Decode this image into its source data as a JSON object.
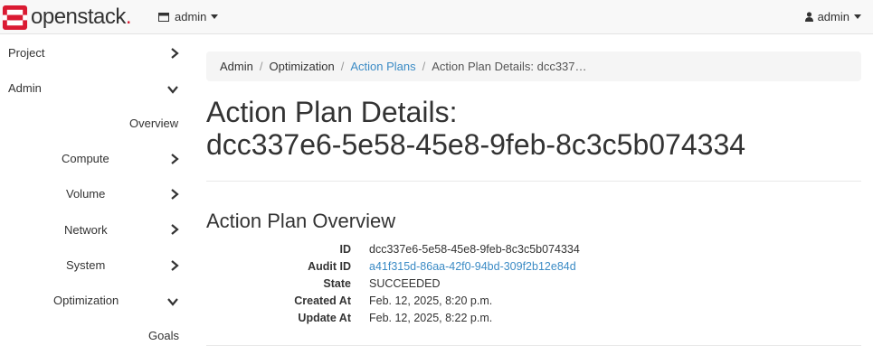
{
  "topbar": {
    "brand": "openstack",
    "brand_dot": ".",
    "project_label": "admin",
    "user_label": "admin"
  },
  "sidebar": {
    "items": [
      {
        "label": "Project",
        "state": "collapsed"
      },
      {
        "label": "Admin",
        "state": "expanded"
      },
      {
        "label": "Overview"
      },
      {
        "label": "Compute",
        "state": "collapsed"
      },
      {
        "label": "Volume",
        "state": "collapsed"
      },
      {
        "label": "Network",
        "state": "collapsed"
      },
      {
        "label": "System",
        "state": "collapsed"
      },
      {
        "label": "Optimization",
        "state": "expanded"
      },
      {
        "label": "Goals"
      }
    ]
  },
  "breadcrumb": {
    "items": [
      "Admin",
      "Optimization",
      "Action Plans",
      "Action Plan Details: dcc337…"
    ],
    "sep": "/"
  },
  "page": {
    "title_line1": "Action Plan Details:",
    "title_line2": "dcc337e6-5e58-45e8-9feb-8c3c5b074334"
  },
  "overview": {
    "title": "Action Plan Overview",
    "rows": [
      {
        "key": "ID",
        "value": "dcc337e6-5e58-45e8-9feb-8c3c5b074334"
      },
      {
        "key": "Audit ID",
        "value": "a41f315d-86aa-42f0-94bd-309f2b12e84d"
      },
      {
        "key": "State",
        "value": "SUCCEEDED"
      },
      {
        "key": "Created At",
        "value": "Feb. 12, 2025, 8:20 p.m."
      },
      {
        "key": "Update At",
        "value": "Feb. 12, 2025, 8:22 p.m."
      }
    ]
  },
  "colors": {
    "accent": "#da1a32",
    "link": "#3b8bc5"
  }
}
